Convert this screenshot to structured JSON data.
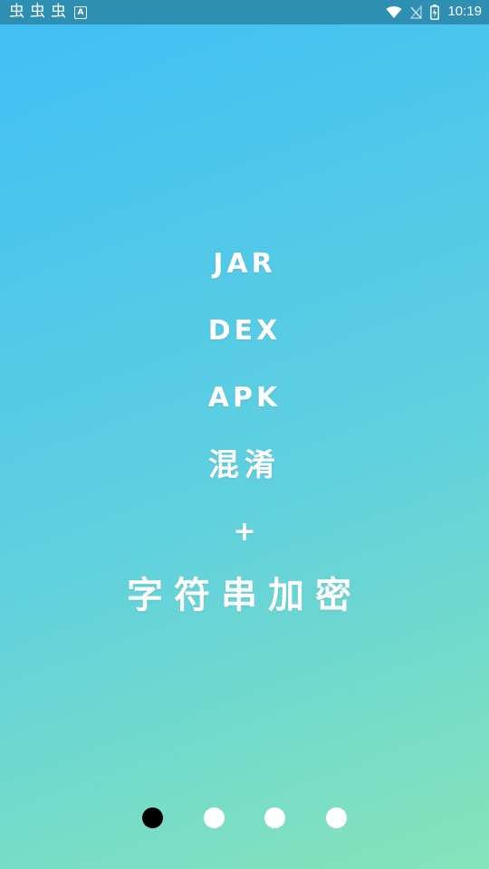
{
  "status_bar": {
    "left_icons": [
      "bug-icon",
      "bug-icon",
      "bug-icon",
      "a-notification-icon"
    ],
    "notification_letter": "A",
    "bug_glyph": "虫",
    "right_icons": [
      "wifi-icon",
      "no-signal-icon",
      "battery-icon"
    ],
    "time": "10:19"
  },
  "slide": {
    "lines": [
      "JAR",
      "DEX",
      "APK",
      "混淆",
      "+",
      "字符串加密"
    ]
  },
  "pager": {
    "page_count": 4,
    "current_page": 1,
    "active_color": "#000000",
    "inactive_color": "#ffffff"
  },
  "background": {
    "gradient_colors": [
      "#40bff6",
      "#5fd0df",
      "#86e4b9"
    ]
  }
}
